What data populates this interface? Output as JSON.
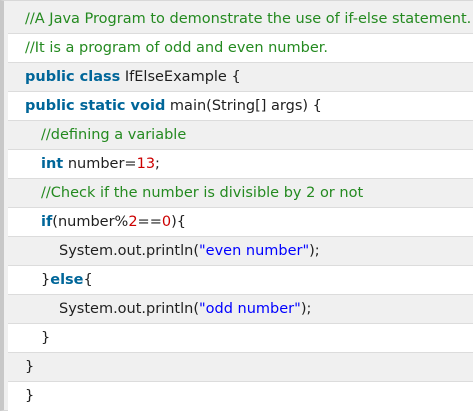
{
  "code": {
    "lines": [
      {
        "indent": 0,
        "tokens": [
          {
            "t": "cm",
            "v": "//A Java Program to demonstrate the use of if-else statement."
          }
        ]
      },
      {
        "indent": 0,
        "tokens": [
          {
            "t": "cm",
            "v": "//It is a program of odd and even number."
          }
        ]
      },
      {
        "indent": 0,
        "tokens": [
          {
            "t": "kwp",
            "v": "public class"
          },
          {
            "t": "pl",
            "v": " IfElseExample {"
          }
        ]
      },
      {
        "indent": 0,
        "tokens": [
          {
            "t": "kwp",
            "v": "public static void"
          },
          {
            "t": "pl",
            "v": " main(String[] args) {"
          }
        ]
      },
      {
        "indent": 1,
        "tokens": [
          {
            "t": "cm",
            "v": "//defining a variable"
          }
        ]
      },
      {
        "indent": 1,
        "tokens": [
          {
            "t": "kwp",
            "v": "int"
          },
          {
            "t": "pl",
            "v": " number="
          },
          {
            "t": "num",
            "v": "13"
          },
          {
            "t": "pl",
            "v": ";"
          }
        ]
      },
      {
        "indent": 1,
        "tokens": [
          {
            "t": "cm",
            "v": "//Check if the number is divisible by 2 or not"
          }
        ]
      },
      {
        "indent": 1,
        "tokens": [
          {
            "t": "kwp",
            "v": "if"
          },
          {
            "t": "pl",
            "v": "(number%"
          },
          {
            "t": "num",
            "v": "2"
          },
          {
            "t": "pl",
            "v": "=="
          },
          {
            "t": "num",
            "v": "0"
          },
          {
            "t": "pl",
            "v": "){"
          }
        ]
      },
      {
        "indent": 2,
        "tokens": [
          {
            "t": "pl",
            "v": "System.out.println("
          },
          {
            "t": "str",
            "v": "\"even number\""
          },
          {
            "t": "pl",
            "v": ");"
          }
        ]
      },
      {
        "indent": 1,
        "tokens": [
          {
            "t": "pl",
            "v": "}"
          },
          {
            "t": "kwp",
            "v": "else"
          },
          {
            "t": "pl",
            "v": "{"
          }
        ]
      },
      {
        "indent": 2,
        "tokens": [
          {
            "t": "pl",
            "v": "System.out.println("
          },
          {
            "t": "str",
            "v": "\"odd number\""
          },
          {
            "t": "pl",
            "v": ");"
          }
        ]
      },
      {
        "indent": 1,
        "tokens": [
          {
            "t": "pl",
            "v": "}"
          }
        ]
      },
      {
        "indent": 0,
        "tokens": [
          {
            "t": "pl",
            "v": "}"
          }
        ]
      },
      {
        "indent": 0,
        "tokens": [
          {
            "t": "pl",
            "v": "}"
          }
        ]
      }
    ]
  },
  "colors": {
    "comment": "#248a20",
    "keyword": "#006699",
    "number": "#cc0000",
    "string": "#0000ff",
    "plain": "#1f1f1f"
  }
}
